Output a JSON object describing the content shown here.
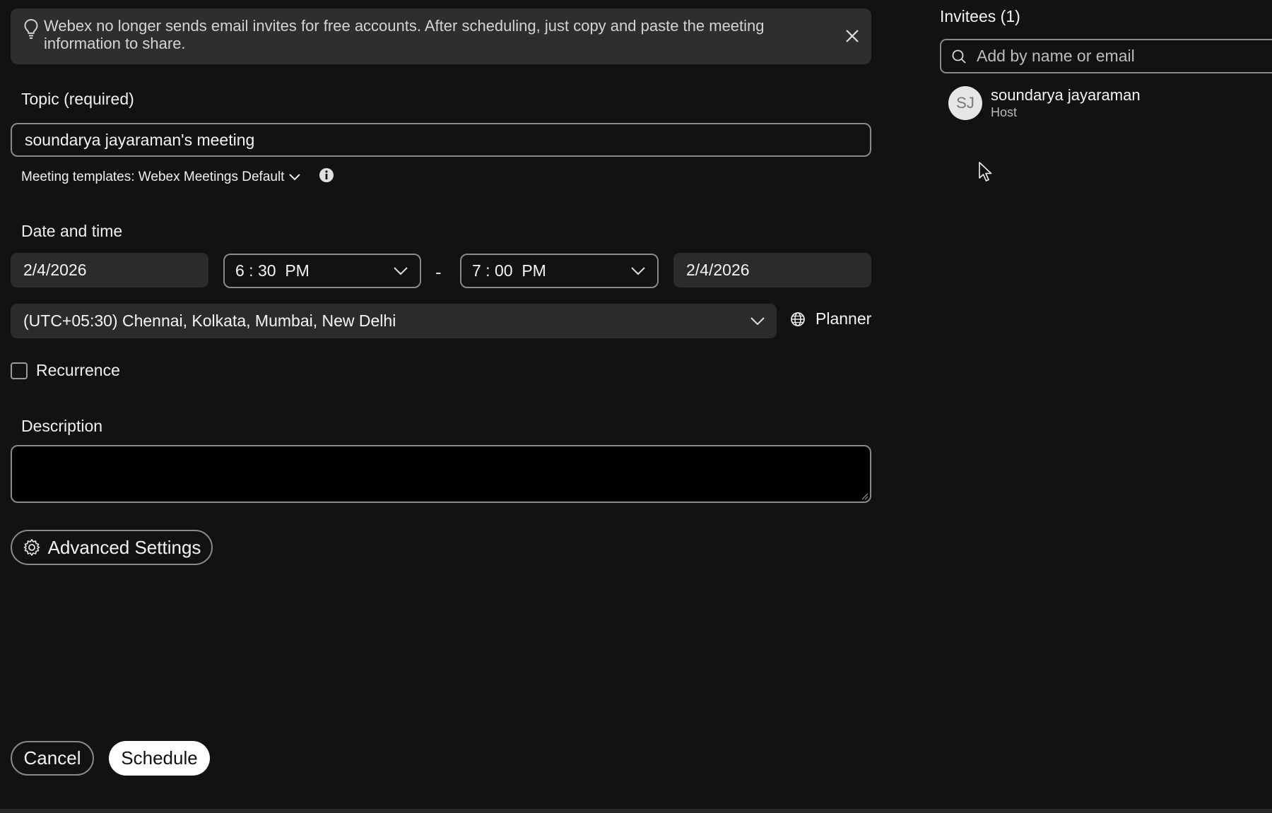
{
  "banner": {
    "message": "Webex no longer sends email invites for free accounts. After scheduling, just copy and paste the meeting information to share."
  },
  "form": {
    "topic_label": "Topic (required)",
    "topic_value": "soundarya jayaraman's meeting",
    "templates_label": "Meeting templates: Webex Meetings Default",
    "datetime_label": "Date and time",
    "start_date": "2/4/2026",
    "start_time": "6 : 30  PM",
    "separator": "-",
    "end_time": "7 : 00  PM",
    "end_date": "2/4/2026",
    "timezone": "(UTC+05:30) Chennai, Kolkata, Mumbai, New Delhi",
    "planner_label": "Planner",
    "recurrence_label": "Recurrence",
    "description_label": "Description",
    "description_value": ""
  },
  "actions": {
    "advanced_label": "Advanced Settings",
    "cancel_label": "Cancel",
    "schedule_label": "Schedule"
  },
  "invitees": {
    "title": "Invitees (1)",
    "search_placeholder": "Add by name or email",
    "people": [
      {
        "initials": "SJ",
        "name": "soundarya jayaraman",
        "role": "Host"
      }
    ]
  },
  "colors": {
    "background": "#121212",
    "banner": "#2e2e2e",
    "input_fill": "#2b2b2b",
    "border": "#8a8a8a",
    "primary_button": "#ffffff"
  }
}
